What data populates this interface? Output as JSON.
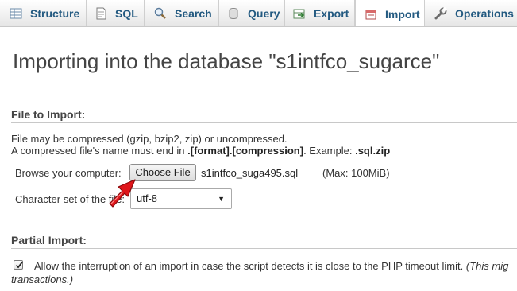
{
  "tabs": [
    {
      "label": "Structure",
      "icon": "structure-icon",
      "active": false
    },
    {
      "label": "SQL",
      "icon": "sql-icon",
      "active": false
    },
    {
      "label": "Search",
      "icon": "search-icon",
      "active": false
    },
    {
      "label": "Query",
      "icon": "query-icon",
      "active": false
    },
    {
      "label": "Export",
      "icon": "export-icon",
      "active": false
    },
    {
      "label": "Import",
      "icon": "import-icon",
      "active": true
    },
    {
      "label": "Operations",
      "icon": "wrench-icon",
      "active": false
    }
  ],
  "page": {
    "title": "Importing into the database \"s1intfco_sugarce\""
  },
  "file_section": {
    "title": "File to Import:",
    "compress_note": "File may be compressed (gzip, bzip2, zip) or uncompressed.",
    "name_note_prefix": "A compressed file's name must end in ",
    "name_note_format": ".[format].[compression]",
    "name_note_example_prefix": ". Example: ",
    "name_note_example": ".sql.zip",
    "browse_label": "Browse your computer:",
    "choose_button": "Choose File",
    "chosen_file": "s1intfco_suga495.sql",
    "max_size": "(Max: 100MiB)",
    "charset_label": "Character set of the file:",
    "charset_value": "utf-8"
  },
  "partial_section": {
    "title": "Partial Import:",
    "allow_interrupt_checked": true,
    "allow_interrupt_label": "Allow the interruption of an import in case the script detects it is close to the PHP timeout limit.",
    "allow_interrupt_note_a": "(This mig",
    "allow_interrupt_note_b": "transactions.)"
  },
  "colors": {
    "tab_text": "#235a81",
    "arrow": "#e0161b",
    "rule": "#c8c8c8"
  }
}
